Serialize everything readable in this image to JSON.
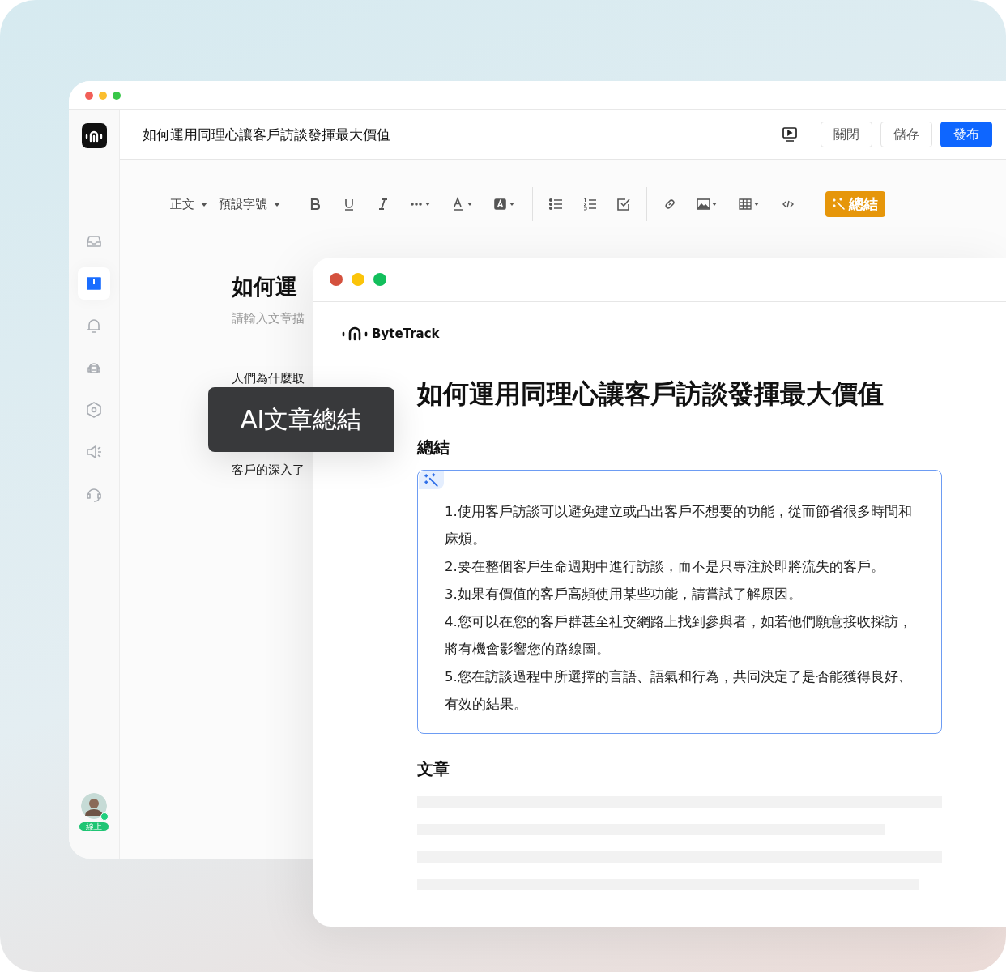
{
  "back_window": {
    "title": "如何運用同理心讓客戶訪談發揮最大價值",
    "buttons": [
      {
        "label": "關閉",
        "kind": "secondary"
      },
      {
        "label": "儲存",
        "kind": "secondary"
      },
      {
        "label": "發布",
        "kind": "primary"
      }
    ],
    "sidebar": {
      "items": [
        {
          "kind": "inbox",
          "selected": false
        },
        {
          "kind": "book",
          "selected": true
        },
        {
          "kind": "bell",
          "selected": false
        },
        {
          "kind": "robot",
          "selected": false
        },
        {
          "kind": "hexagon",
          "selected": false
        },
        {
          "kind": "speaker",
          "selected": false
        },
        {
          "kind": "headset",
          "selected": false
        }
      ]
    },
    "user": {
      "status": "線上",
      "online": true
    },
    "toolbar": [
      {
        "kind": "dropdown",
        "label": "正文"
      },
      {
        "kind": "dropdown",
        "label": "預設字號"
      },
      {
        "kind": "divider"
      },
      {
        "kind": "bold"
      },
      {
        "kind": "underline"
      },
      {
        "kind": "italic"
      },
      {
        "kind": "more"
      },
      {
        "kind": "font-color"
      },
      {
        "kind": "highlight"
      },
      {
        "kind": "divider"
      },
      {
        "kind": "bullet-list"
      },
      {
        "kind": "numbered-list"
      },
      {
        "kind": "checklist"
      },
      {
        "kind": "divider"
      },
      {
        "kind": "link"
      },
      {
        "kind": "image"
      },
      {
        "kind": "table"
      },
      {
        "kind": "code"
      },
      {
        "kind": "ai",
        "label": "總結"
      }
    ],
    "document": {
      "title": "如何運",
      "placeholder": "請輸入文章描",
      "paragraphs": [
        "人們為什麼取",
        "客戶的深入了"
      ]
    }
  },
  "tooltip": {
    "text": "AI文章總結"
  },
  "front_window": {
    "brand": "ByteTrack",
    "title": "如何運用同理心讓客戶訪談發揮最大價值",
    "summary_heading": "總結",
    "summary_items": [
      "1.使用客戶訪談可以避免建立或凸出客戶不想要的功能，從而節省很多時間和麻煩。",
      "2.要在整個客戶生命週期中進行訪談，而不是只專注於即將流失的客戶。",
      "3.如果有價值的客戶高頻使用某些功能，請嘗試了解原因。",
      "4.您可以在您的客戶群甚至社交網路上找到參與者，如若他們願意接收採訪，將有機會影響您的路線圖。",
      "5.您在訪談過程中所選擇的言語、語氣和行為，共同決定了是否能獲得良好、有效的結果。"
    ],
    "article_heading": "文章"
  }
}
